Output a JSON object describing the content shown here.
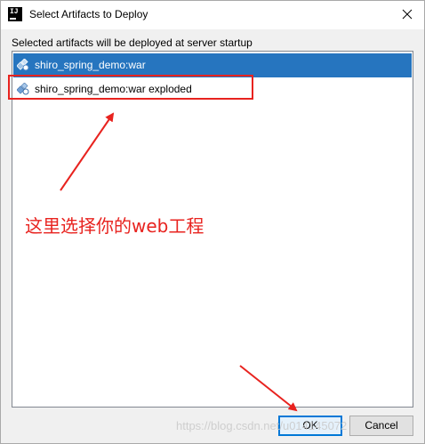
{
  "window": {
    "title": "Select Artifacts to Deploy",
    "app_icon_text": "IJ"
  },
  "caption": "Selected artifacts will be deployed at server startup",
  "artifacts": [
    {
      "label": "shiro_spring_demo:war",
      "selected": true,
      "icon": "artifact-icon"
    },
    {
      "label": "shiro_spring_demo:war exploded",
      "selected": false,
      "icon": "artifact-icon"
    }
  ],
  "annotation": {
    "text": "这里选择你的web工程",
    "color": "#e8231f"
  },
  "buttons": {
    "ok_label": "OK",
    "cancel_label": "Cancel"
  },
  "watermark": "https://blog.csdn.net/u014145072",
  "colors": {
    "selection": "#2675bf",
    "annotation_red": "#e8231f",
    "default_button_border": "#0078d7"
  }
}
